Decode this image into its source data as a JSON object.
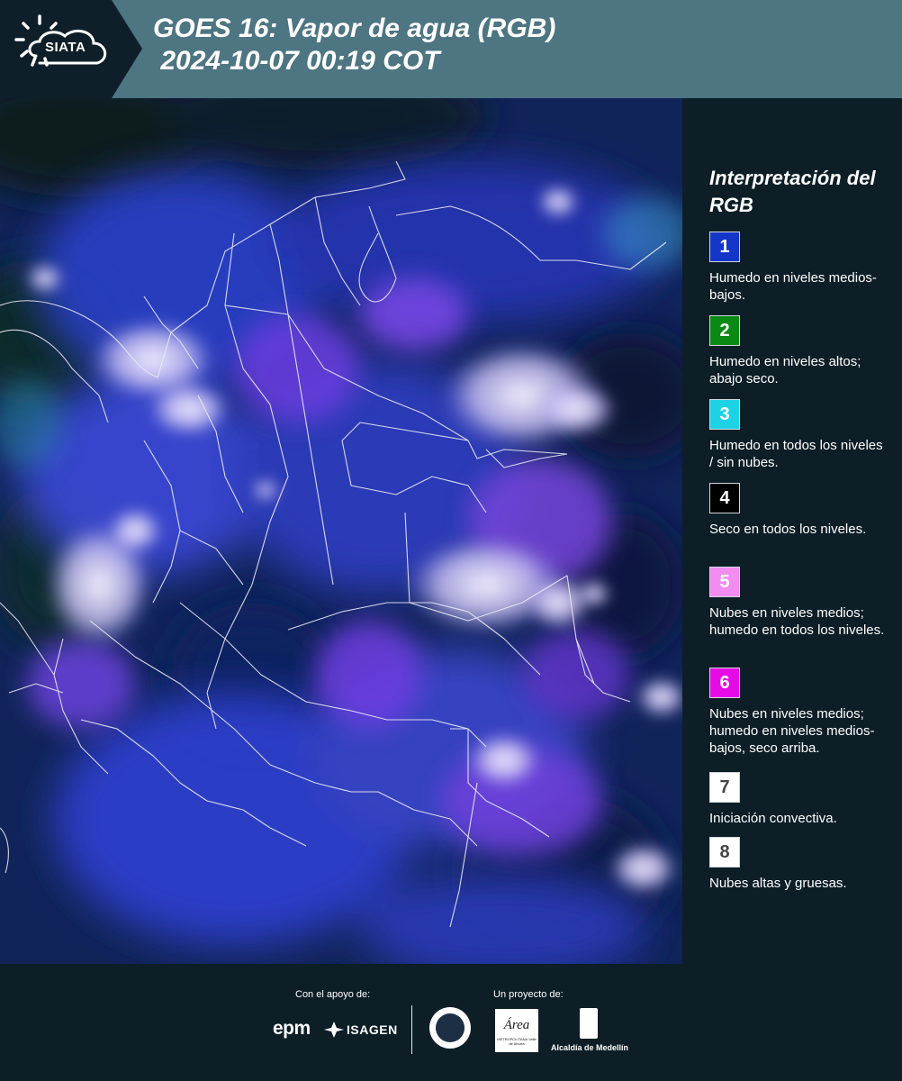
{
  "header": {
    "logo_text": "SIATA",
    "title": "GOES 16: Vapor de agua (RGB)\n 2024-10-07 00:19 COT"
  },
  "legend": {
    "title": "Interpretación del RGB",
    "items": [
      {
        "num": "1",
        "color": "#1436c8",
        "desc": "Humedo en niveles medios-bajos."
      },
      {
        "num": "2",
        "color": "#0a8a14",
        "desc": "Humedo en niveles altos; abajo seco."
      },
      {
        "num": "3",
        "color": "#1ed2e6",
        "desc": "Humedo en todos los niveles / sin nubes."
      },
      {
        "num": "4",
        "color": "#000000",
        "desc": "Seco en todos los niveles."
      },
      {
        "num": "5",
        "color": "#f28cf0",
        "desc": "Nubes en niveles medios; humedo en todos los niveles."
      },
      {
        "num": "6",
        "color": "#e60ae6",
        "desc": "Nubes en niveles medios; humedo en niveles medios-bajos, seco arriba."
      },
      {
        "num": "7",
        "color": "#ffffff",
        "desc": "Iniciación convectiva."
      },
      {
        "num": "8",
        "color": "#ffffff",
        "desc": "Nubes altas y gruesas."
      }
    ]
  },
  "footer": {
    "support_label": "Con el apoyo de:",
    "project_label": "Un proyecto de:",
    "sponsor1": "epm",
    "sponsor2": "ISAGEN",
    "partner_area": "Área",
    "partner_area_sub": "METROPOLITANA Valle de Aburrá",
    "partner_alcaldia": "Alcaldía de Medellín"
  },
  "map": {
    "imagery": "GOES-16 water vapor RGB composite over Colombia",
    "background_color": "#0a1a3a"
  }
}
